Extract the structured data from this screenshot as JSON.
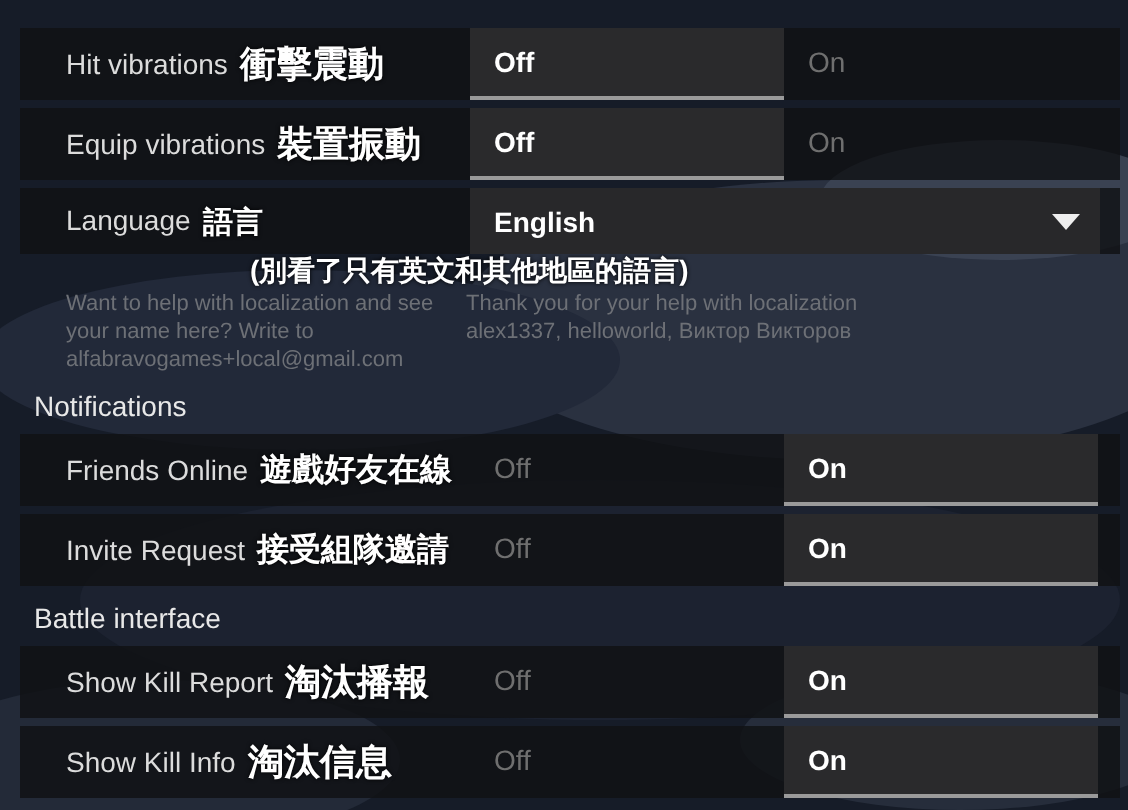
{
  "sections": [
    {
      "rows": [
        {
          "kind": "toggle",
          "label": "Hit vibrations",
          "caption": "衝擊震動",
          "options": [
            {
              "label": "Off",
              "selected": true
            },
            {
              "label": "On",
              "selected": false
            }
          ]
        },
        {
          "kind": "toggle",
          "label": "Equip vibrations",
          "caption": "裝置振動",
          "options": [
            {
              "label": "Off",
              "selected": true
            },
            {
              "label": "On",
              "selected": false
            }
          ]
        },
        {
          "kind": "dropdown",
          "label": "Language",
          "caption": "語言",
          "overlay_caption": "(別看了只有英文和其他地區的語言)",
          "value": "English",
          "help_left": "Want to help with localization and see your name here? Write to alfabravogames+local@gmail.com",
          "help_right": "Thank you for your help with localization alex1337, helloworld, Виктор Викторов"
        }
      ]
    },
    {
      "title": "Notifications",
      "rows": [
        {
          "kind": "toggle",
          "label": "Friends Online",
          "caption": "遊戲好友在線",
          "options": [
            {
              "label": "Off",
              "selected": false
            },
            {
              "label": "On",
              "selected": true
            }
          ]
        },
        {
          "kind": "toggle",
          "label": "Invite Request",
          "caption": "接受組隊邀請",
          "options": [
            {
              "label": "Off",
              "selected": false
            },
            {
              "label": "On",
              "selected": true
            }
          ]
        }
      ]
    },
    {
      "title": "Battle interface",
      "rows": [
        {
          "kind": "toggle",
          "label": "Show Kill Report",
          "caption": "淘汰播報",
          "options": [
            {
              "label": "Off",
              "selected": false
            },
            {
              "label": "On",
              "selected": true
            }
          ]
        },
        {
          "kind": "toggle",
          "label": "Show Kill Info",
          "caption": "淘汰信息",
          "options": [
            {
              "label": "Off",
              "selected": false
            },
            {
              "label": "On",
              "selected": true
            }
          ]
        }
      ]
    }
  ]
}
